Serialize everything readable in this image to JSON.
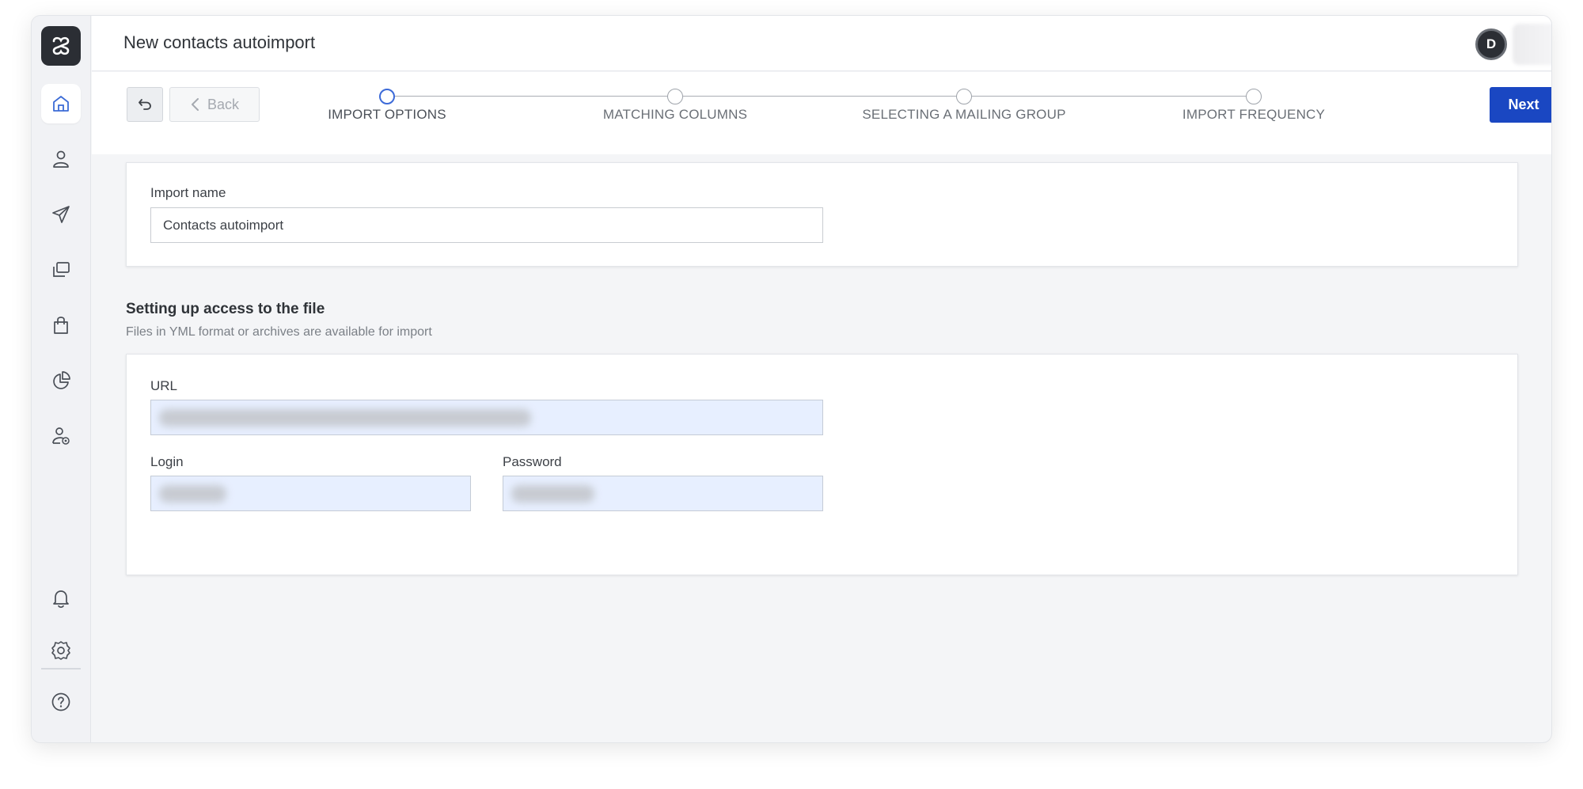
{
  "header": {
    "title": "New contacts autoimport",
    "avatar_initial": "D"
  },
  "sidebar": {
    "items": [
      {
        "icon": "home-icon",
        "active": true
      },
      {
        "icon": "user-icon",
        "active": false
      },
      {
        "icon": "send-icon",
        "active": false
      },
      {
        "icon": "templates-icon",
        "active": false
      },
      {
        "icon": "shopping-bag-icon",
        "active": false
      },
      {
        "icon": "pie-chart-icon",
        "active": false
      },
      {
        "icon": "user-settings-icon",
        "active": false
      },
      {
        "icon": "bell-icon",
        "active": false
      },
      {
        "icon": "gear-icon",
        "active": false
      },
      {
        "icon": "help-icon",
        "active": false
      }
    ]
  },
  "toolbar": {
    "back_label": "Back",
    "next_label": "Next",
    "steps": [
      {
        "label": "IMPORT OPTIONS",
        "active": true
      },
      {
        "label": "MATCHING COLUMNS",
        "active": false
      },
      {
        "label": "SELECTING A MAILING GROUP",
        "active": false
      },
      {
        "label": "IMPORT FREQUENCY",
        "active": false
      }
    ]
  },
  "import_card": {
    "name_label": "Import name",
    "name_value": "Contacts autoimport"
  },
  "file_access": {
    "title": "Setting up access to the file",
    "subtitle": "Files in YML format or archives are available for import",
    "url_label": "URL",
    "login_label": "Login",
    "password_label": "Password"
  },
  "colors": {
    "accent": "#1a47c2",
    "active_step": "#3c6ad8",
    "filled_input": "#e7efff"
  }
}
